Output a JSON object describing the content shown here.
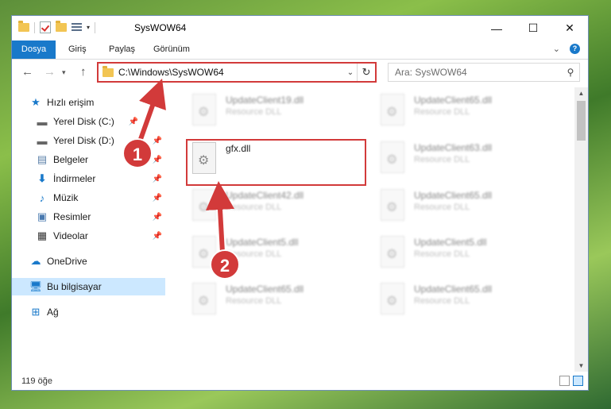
{
  "window": {
    "title": "SysWOW64",
    "min_icon": "minimize-icon",
    "max_icon": "maximize-icon",
    "close_icon": "close-icon"
  },
  "ribbon": {
    "tabs": [
      "Dosya",
      "Giriş",
      "Paylaş",
      "Görünüm"
    ],
    "file_tab_color": "#1979ca"
  },
  "address": {
    "path": "C:\\Windows\\SysWOW64",
    "search_placeholder": "Ara: SysWOW64"
  },
  "nav": {
    "items": [
      {
        "label": "Hızlı erişim",
        "icon": "star-icon"
      },
      {
        "label": "Yerel Disk (C:)",
        "icon": "drive-icon"
      },
      {
        "label": "Yerel Disk (D:)",
        "icon": "drive-icon"
      },
      {
        "label": "Belgeler",
        "icon": "documents-icon"
      },
      {
        "label": "İndirmeler",
        "icon": "download-icon"
      },
      {
        "label": "Müzik",
        "icon": "music-icon"
      },
      {
        "label": "Resimler",
        "icon": "pictures-icon"
      },
      {
        "label": "Videolar",
        "icon": "videos-icon"
      },
      {
        "label": "OneDrive",
        "icon": "cloud-icon"
      },
      {
        "label": "Bu bilgisayar",
        "icon": "computer-icon"
      },
      {
        "label": "Ağ",
        "icon": "network-icon"
      }
    ]
  },
  "files": {
    "left": [
      {
        "name": "UpdateClient19.dll",
        "type": "Resource DLL"
      },
      {
        "name": "gfx.dll",
        "type": ""
      },
      {
        "name": "UpdateClient42.dll",
        "type": "Resource DLL"
      },
      {
        "name": "UpdateClient5.dll",
        "type": "Resource DLL"
      },
      {
        "name": "UpdateClient65.dll",
        "type": "Resource DLL"
      }
    ],
    "right": [
      {
        "name": "UpdateClient65.dll",
        "type": "Resource DLL"
      },
      {
        "name": "UpdateClient63.dll",
        "type": "Resource DLL"
      },
      {
        "name": "UpdateClient65.dll",
        "type": "Resource DLL"
      },
      {
        "name": "UpdateClient5.dll",
        "type": "Resource DLL"
      },
      {
        "name": "UpdateClient65.dll",
        "type": "Resource DLL"
      }
    ]
  },
  "status": {
    "count": "119 öğe"
  },
  "callouts": {
    "one": "1",
    "two": "2",
    "color": "#d23a3a"
  }
}
